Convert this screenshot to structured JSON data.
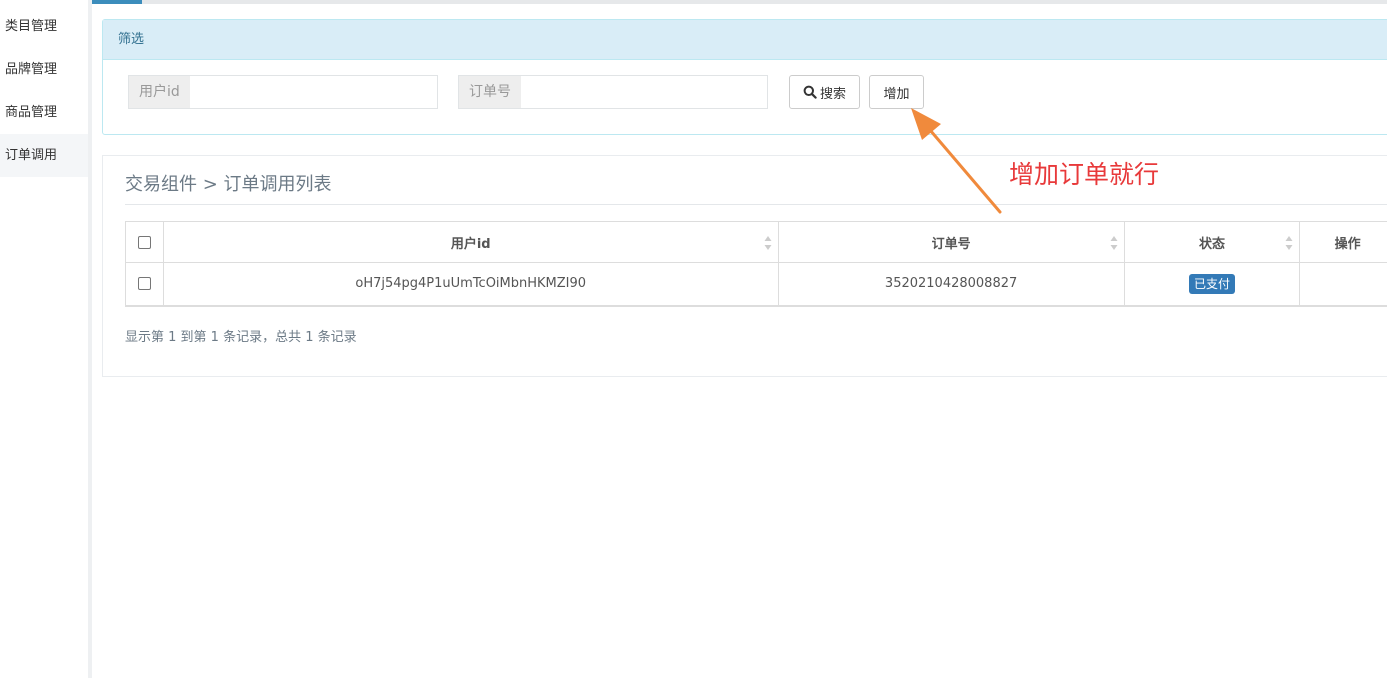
{
  "sidebar": {
    "items": [
      {
        "label": "类目管理"
      },
      {
        "label": "品牌管理"
      },
      {
        "label": "商品管理"
      },
      {
        "label": "订单调用",
        "active": true
      }
    ]
  },
  "filter": {
    "heading": "筛选",
    "user_id_label": "用户id",
    "user_id_value": "",
    "order_no_label": "订单号",
    "order_no_value": "",
    "search_button": "搜索",
    "add_button": "增加"
  },
  "list": {
    "breadcrumb": "交易组件 > 订单调用列表",
    "columns": [
      "用户id",
      "订单号",
      "状态",
      "操作"
    ],
    "rows": [
      {
        "user_id": "oH7j54pg4P1uUmTcOiMbnHKMZI90",
        "order_no": "3520210428008827",
        "status": "已支付",
        "action": ""
      }
    ],
    "pagination_info": "显示第 1 到第 1 条记录，总共 1 条记录"
  },
  "annotation": {
    "text": "增加订单就行",
    "color": "#e8393a",
    "arrow_color": "#f08a3c"
  },
  "colors": {
    "accent": "#3c8dbc",
    "status_badge": "#337ab7",
    "filter_heading_bg": "#d9edf7"
  }
}
